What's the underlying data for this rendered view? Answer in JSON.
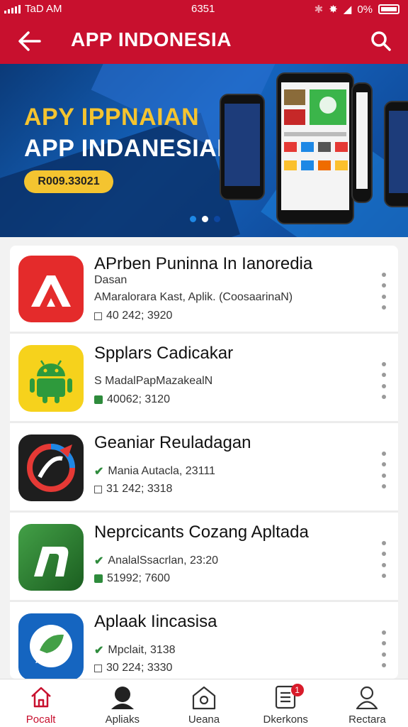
{
  "status_bar": {
    "time_left": "TaD AM",
    "time_center": "6351",
    "battery": "0%"
  },
  "header": {
    "title": "APP INDONESIA"
  },
  "banner": {
    "headline_1": "APY IPPNAIAN",
    "headline_2": "APP INDANESIAI",
    "pill": "R009.33021",
    "carousel_active_index": 1,
    "carousel_count": 3
  },
  "apps": [
    {
      "name": "APrben Puninna In Ianoredia",
      "line1": "Dasan",
      "line2": "AMaralorara Kast, Aplik. (CoosaarinaN)",
      "line3": "40 242; 3920",
      "icon": "red-a-icon"
    },
    {
      "name": "Spplars Cadicakar",
      "line1": "",
      "line2": "S MadalPapMazakealN",
      "line3": "40062; 3120",
      "icon": "android-icon"
    },
    {
      "name": "Geaniar Reuladagan",
      "line1": "",
      "line2": "Mania Autacla, 23111",
      "line3": "31 242; 3318",
      "icon": "swirl-icon"
    },
    {
      "name": "Neprcicants Cozang Apltada",
      "line1": "",
      "line2": "AnalalSsacrlan, 23:20",
      "line3": "51992; 7600",
      "icon": "green-n-icon"
    },
    {
      "name": "Aplaak Iincasisa",
      "line1": "",
      "line2": "Mpclait, 3138",
      "line3": "30 224; 3330",
      "icon": "chat-bubble-icon"
    }
  ],
  "bottom_nav": [
    {
      "label": "Pocalt",
      "icon": "home-icon",
      "active": true
    },
    {
      "label": "Apliaks",
      "icon": "person-icon",
      "active": false
    },
    {
      "label": "Ueana",
      "icon": "house-outline-icon",
      "active": false
    },
    {
      "label": "Dkerkons",
      "icon": "list-icon",
      "active": false,
      "badge": "1"
    },
    {
      "label": "Rectara",
      "icon": "profile-icon",
      "active": false
    }
  ],
  "colors": {
    "brand_red": "#c8102e",
    "banner_blue": "#1565c0",
    "accent_yellow": "#f4c430"
  }
}
